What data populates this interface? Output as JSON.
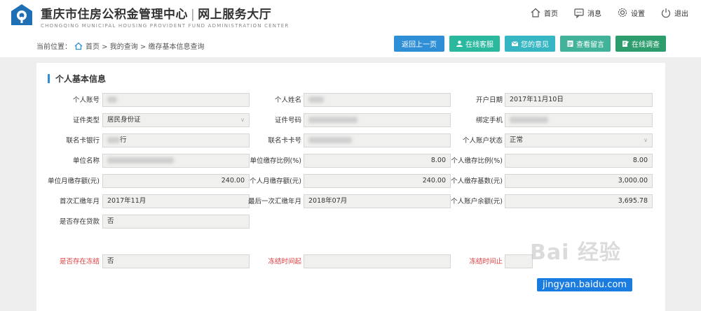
{
  "header": {
    "title_main": "重庆市住房公积金管理中心",
    "title_sep": "|",
    "title_sub": "网上服务大厅",
    "subtitle_en": "CHONGQING MUNICIPAL HOUSING PROVIDENT FUND ADMINISTRATION CENTER",
    "nav": [
      {
        "label": "首页",
        "icon": "home-icon"
      },
      {
        "label": "消息",
        "icon": "message-icon"
      },
      {
        "label": "设置",
        "icon": "gear-icon"
      },
      {
        "label": "退出",
        "icon": "power-icon"
      }
    ]
  },
  "breadcrumb": {
    "prefix": "当前位置：",
    "path": "首页 > 我的查询 > 缴存基本信息查询"
  },
  "actions": {
    "back": "返回上一页",
    "service": "在线客服",
    "feedback": "您的意见",
    "message": "查看留言",
    "survey": "在线调查"
  },
  "section": {
    "title": "个人基本信息"
  },
  "fields": {
    "r1": {
      "l1": "个人账号",
      "v1": "",
      "l2": "个人姓名",
      "v2": "",
      "l3": "开户日期",
      "v3": "2017年11月10日"
    },
    "r2": {
      "l1": "证件类型",
      "v1": "居民身份证",
      "l2": "证件号码",
      "v2": "",
      "l3": "绑定手机",
      "v3": ""
    },
    "r3": {
      "l1": "联名卡银行",
      "v1": "行",
      "l2": "联名卡卡号",
      "v2": "",
      "l3": "个人账户状态",
      "v3": "正常"
    },
    "r4": {
      "l1": "单位名称",
      "v1": "",
      "l2": "单位缴存比例(%)",
      "v2": "8.00",
      "l3": "个人缴存比例(%)",
      "v3": "8.00"
    },
    "r5": {
      "l1": "单位月缴存额(元)",
      "v1": "240.00",
      "l2": "个人月缴存额(元)",
      "v2": "240.00",
      "l3": "个人缴存基数(元)",
      "v3": "3,000.00"
    },
    "r6": {
      "l1": "首次汇缴年月",
      "v1": "2017年11月",
      "l2": "最后一次汇缴年月",
      "v2": "2018年07月",
      "l3": "个人账户余额(元)",
      "v3": "3,695.78"
    },
    "r7": {
      "l1": "是否存在贷款",
      "v1": "否"
    },
    "r8": {
      "l1": "是否存在冻结",
      "v1": "否",
      "l2": "冻结时间起",
      "v2": "",
      "l3": "冻结时间止",
      "v3": ""
    }
  },
  "watermark": {
    "text": "Bai 经验",
    "url": "jingyan.baidu.com"
  },
  "colors": {
    "primary": "#2f8fd6",
    "warning_label": "#e03b3b"
  }
}
